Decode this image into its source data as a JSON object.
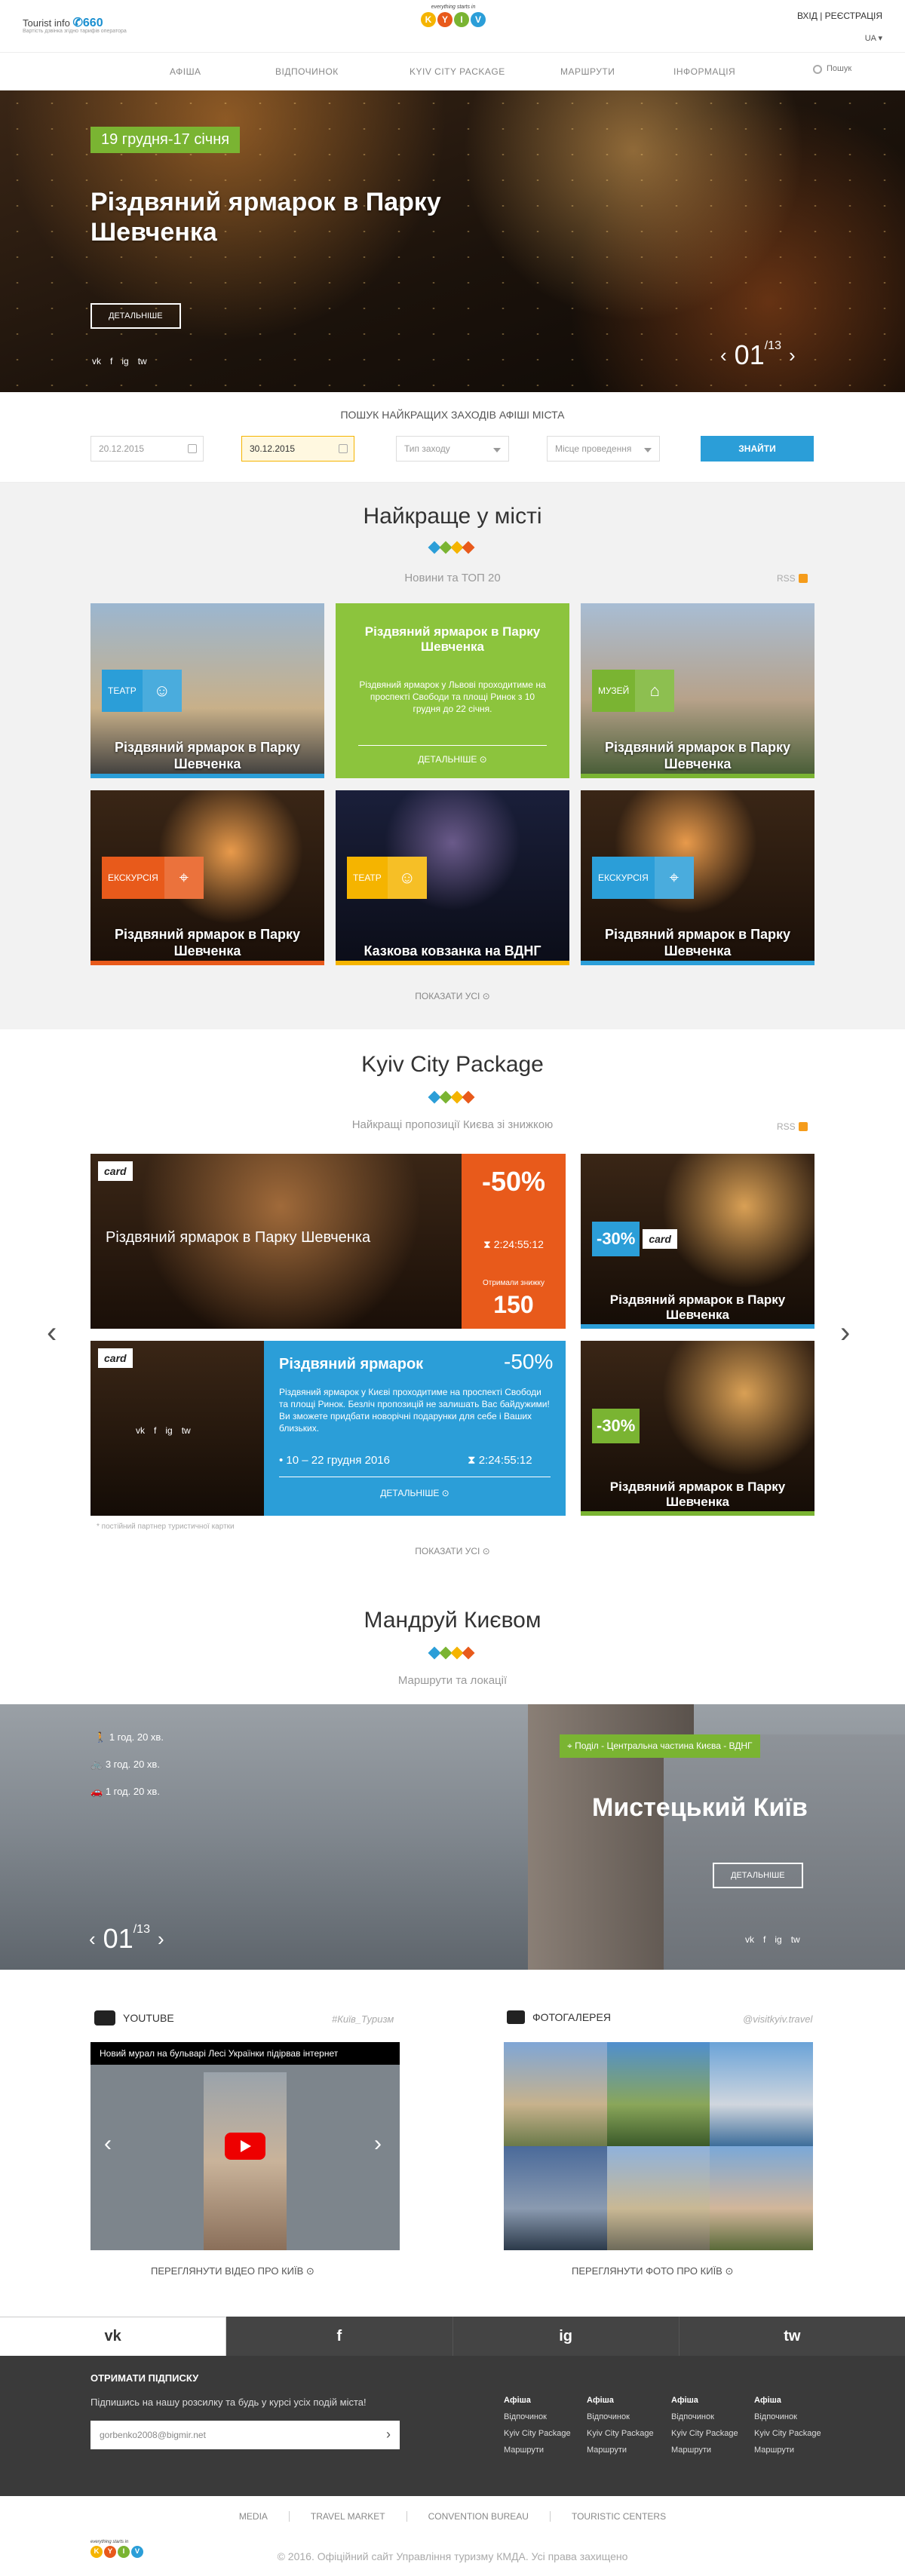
{
  "header": {
    "brand": "Tourist info",
    "brand_phone": "✆660",
    "brand_sub": "Вартість дзвінка згідно тарифів оператора",
    "logo_tag": "everything starts in",
    "logo_letters": [
      "K",
      "Y",
      "I",
      "V"
    ],
    "logo_colors": [
      "#f5b400",
      "#e85a1b",
      "#7ab432",
      "#2b9ed8"
    ],
    "login": "ВХІД | РЕЄСТРАЦІЯ",
    "lang": "UA",
    "nav": [
      "АФІША",
      "ВІДПОЧИНОК",
      "KYIV CITY PACKAGE",
      "МАРШРУТИ",
      "ІНФОРМАЦІЯ"
    ],
    "search_placeholder": "Пошук"
  },
  "hero": {
    "date": "19 грудня-17 січня",
    "title": "Різдвяний ярмарок в Парку Шевченка",
    "more": "ДЕТАЛЬНІШЕ",
    "social": [
      "vk",
      "f",
      "ig",
      "tw"
    ],
    "page": "01",
    "total": "/13"
  },
  "search": {
    "title": "ПОШУК НАЙКРАЩИХ ЗАХОДІВ АФІШІ МІСТА",
    "date_from": "20.12.2015",
    "date_to": "30.12.2015",
    "type_placeholder": "Тип заходу",
    "place_placeholder": "Місце проведення",
    "button": "ЗНАЙТИ"
  },
  "best": {
    "title": "Найкраще у місті",
    "subtitle": "Новини та ТОП 20",
    "rss": "RSS",
    "show_all": "ПОКАЗАТИ УСІ",
    "cards": [
      {
        "badge": "ТЕАТР",
        "title": "Різдвяний ярмарок в Парку Шевченка",
        "color": "#2b9ed8"
      },
      {
        "title": "Різдвяний ярмарок в Парку Шевченка",
        "text": "Різдвяний ярмарок у Львові проходитиме на проспекті Свободи та площі Ринок з 10 грудня до 22 січня.",
        "more": "ДЕТАЛЬНІШЕ",
        "color": "#7ab432"
      },
      {
        "badge": "МУЗЕЙ",
        "title": "Різдвяний ярмарок в Парку Шевченка",
        "color": "#7ab432"
      },
      {
        "badge": "ЕКСКУРСІЯ",
        "title": "Різдвяний ярмарок в Парку Шевченка",
        "color": "#e85a1b"
      },
      {
        "badge": "ТЕАТР",
        "title": "Казкова ковзанка на ВДНГ",
        "color": "#f5b400"
      },
      {
        "badge": "ЕКСКУРСІЯ",
        "title": "Різдвяний ярмарок в Парку Шевченка",
        "color": "#2b9ed8"
      }
    ]
  },
  "package": {
    "title": "Kyiv City Package",
    "subtitle": "Найкращі пропозиції Києва зі знижкою",
    "rss": "RSS",
    "card_label": "card",
    "big": {
      "title": "Різдвяний ярмарок в Парку Шевченка",
      "discount": "-50%",
      "timer": "2:24:55:12",
      "got_label": "Отримали знижку",
      "got_count": "150"
    },
    "side1": {
      "discount": "-30%",
      "title": "Різдвяний ярмарок в Парку Шевченка"
    },
    "detail": {
      "title": "Різдвяний ярмарок",
      "discount": "-50%",
      "text": "Різдвяний ярмарок у Києві проходитиме на проспекті Свободи та площі Ринок. Безліч пропозицій не залишать Вас байдужими! Ви зможете придбати новорічні подарунки для себе і Ваших близьких.",
      "dates": "10 – 22 грудня 2016",
      "timer": "2:24:55:12",
      "more": "ДЕТАЛЬНІШЕ"
    },
    "side2": {
      "discount": "-30%",
      "title": "Різдвяний ярмарок в Парку Шевченка"
    },
    "note": "* постійний партнер туристичної картки",
    "show_all": "ПОКАЗАТИ УСІ"
  },
  "routes": {
    "title": "Мандруй Києвом",
    "subtitle": "Маршрути та локації",
    "walk": "1 год. 20 хв.",
    "bike": "3 год. 20 хв.",
    "car": "1 год. 20 хв.",
    "tag": "Поділ - Центральна частина Києва - ВДНГ",
    "name": "Мистецький Київ",
    "more": "ДЕТАЛЬНІШЕ",
    "page": "01",
    "total": "/13"
  },
  "media": {
    "yt_label": "YOUTUBE",
    "yt_hash": "#Київ_Туризм",
    "yt_video_title": "Новий мурал на бульварі Лесі Українки підірвав інтернет",
    "yt_more": "ПЕРЕГЛЯНУТИ ВІДЕО ПРО КИЇВ",
    "gal_label": "ФОТОГАЛЕРЕЯ",
    "gal_hash": "@visitkyiv.travel",
    "gal_more": "ПЕРЕГЛЯНУТИ ФОТО ПРО КИЇВ"
  },
  "social_bar": [
    "vk",
    "f",
    "ig",
    "tw"
  ],
  "footer": {
    "sub_title": "ОТРИМАТИ ПІДПИСКУ",
    "sub_text": "Підпишись на нашу розсилку та будь у курсі усіх подій міста!",
    "sub_email": "gorbenko2008@bigmir.net",
    "columns": [
      {
        "h": "Афіша",
        "items": [
          "Відпочинок",
          "Kyiv City Package",
          "Маршрути"
        ]
      },
      {
        "h": "Афіша",
        "items": [
          "Відпочинок",
          "Kyiv City Package",
          "Маршрути"
        ]
      },
      {
        "h": "Афіша",
        "items": [
          "Відпочинок",
          "Kyiv City Package",
          "Маршрути"
        ]
      },
      {
        "h": "Афіша",
        "items": [
          "Відпочинок",
          "Kyiv City Package",
          "Маршрути"
        ]
      }
    ],
    "links": [
      "MEDIA",
      "TRAVEL MARKET",
      "CONVENTION BUREAU",
      "TOURISTIC CENTERS"
    ],
    "copyright": "© 2016. Офіційний сайт Управління туризму КМДА. Усі права захищено"
  }
}
